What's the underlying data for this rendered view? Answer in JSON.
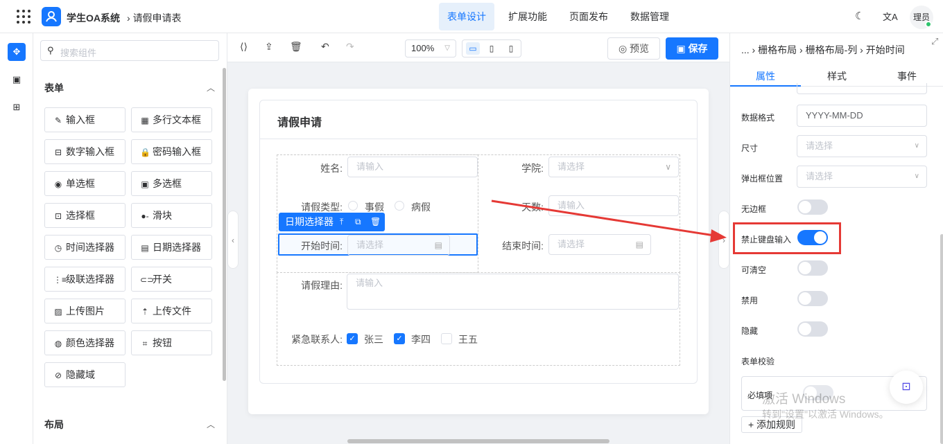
{
  "header": {
    "app_title": "学生OA系统",
    "breadcrumb": "请假申请表",
    "nav": [
      "表单设计",
      "扩展功能",
      "页面发布",
      "数据管理"
    ],
    "active_nav_index": 0,
    "avatar_text": "理员",
    "dark_mode_icon": "moon-icon",
    "translate_icon": "translate-icon"
  },
  "components": {
    "search_placeholder": "搜索组件",
    "section_form": "表单",
    "section_layout": "布局",
    "items": [
      {
        "label": "输入框",
        "icon": "pen-icon"
      },
      {
        "label": "多行文本框",
        "icon": "textarea-icon"
      },
      {
        "label": "数字输入框",
        "icon": "number-icon"
      },
      {
        "label": "密码输入框",
        "icon": "lock-icon"
      },
      {
        "label": "单选框",
        "icon": "radio-icon"
      },
      {
        "label": "多选框",
        "icon": "checkbox-icon"
      },
      {
        "label": "选择框",
        "icon": "select-icon"
      },
      {
        "label": "滑块",
        "icon": "slider-icon"
      },
      {
        "label": "时间选择器",
        "icon": "clock-icon"
      },
      {
        "label": "日期选择器",
        "icon": "calendar-icon"
      },
      {
        "label": "级联选择器",
        "icon": "cascader-icon"
      },
      {
        "label": "开关",
        "icon": "switch-icon"
      },
      {
        "label": "上传图片",
        "icon": "image-icon"
      },
      {
        "label": "上传文件",
        "icon": "upload-icon"
      },
      {
        "label": "颜色选择器",
        "icon": "palette-icon"
      },
      {
        "label": "按钮",
        "icon": "button-icon"
      },
      {
        "label": "隐藏域",
        "icon": "eye-off-icon"
      }
    ]
  },
  "toolbar": {
    "zoom": "100%",
    "preview_label": "预览",
    "save_label": "保存"
  },
  "form": {
    "title": "请假申请",
    "name_label": "姓名:",
    "name_placeholder": "请输入",
    "college_label": "学院:",
    "college_placeholder": "请选择",
    "leave_type_label": "请假类型:",
    "leave_type_options": [
      "事假",
      "病假"
    ],
    "days_label": "天数:",
    "days_placeholder": "请输入",
    "selected_component_tag": "日期选择器",
    "start_label": "开始时间:",
    "start_placeholder": "请选择",
    "end_label": "结束时间:",
    "end_placeholder": "请选择",
    "reason_label": "请假理由:",
    "reason_placeholder": "请输入",
    "contact_label": "紧急联系人:",
    "contacts": [
      {
        "name": "张三",
        "checked": true
      },
      {
        "name": "李四",
        "checked": true
      },
      {
        "name": "王五",
        "checked": false
      }
    ]
  },
  "props": {
    "breadcrumb": [
      "...",
      "栅格布局",
      "栅格布局-列",
      "开始时间"
    ],
    "tabs": [
      "属性",
      "样式",
      "事件"
    ],
    "active_tab_index": 0,
    "data_format_label": "数据格式",
    "data_format_value": "YYYY-MM-DD",
    "size_label": "尺寸",
    "size_placeholder": "请选择",
    "popup_position_label": "弹出框位置",
    "popup_position_placeholder": "请选择",
    "borderless_label": "无边框",
    "borderless_on": false,
    "disable_keyboard_label": "禁止键盘输入",
    "disable_keyboard_on": true,
    "clearable_label": "可清空",
    "clearable_on": false,
    "disabled_label": "禁用",
    "disabled_on": false,
    "hidden_label": "隐藏",
    "hidden_on": false,
    "validation_label": "表单校验",
    "required_label": "必填项",
    "add_rule_label": "添加规则"
  },
  "watermark": {
    "line1": "激活 Windows",
    "line2": "转到\"设置\"以激活 Windows。"
  },
  "colors": {
    "primary": "#1677ff",
    "highlight_red": "#e53935",
    "canvas_bg": "#f0f2f5"
  }
}
